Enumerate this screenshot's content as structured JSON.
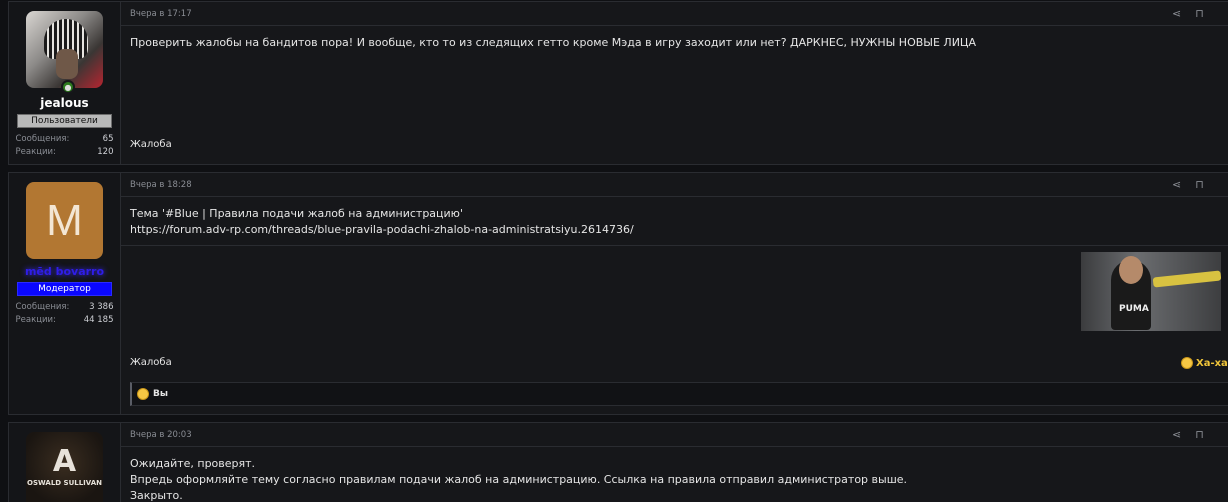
{
  "posts": [
    {
      "user": {
        "name": "jealous",
        "badge": "Пользователи",
        "messages_label": "Сообщения:",
        "messages": "65",
        "reactions_label": "Реакции:",
        "reactions": "120"
      },
      "time": "Вчера в 17:17",
      "body": "Проверить жалобы на бандитов пора! И вообще, кто то из следящих гетто кроме Мэда в игру заходит или нет? ДАРКНЕС, НУЖНЫ НОВЫЕ ЛИЦА",
      "report": "Жалоба"
    },
    {
      "user": {
        "avatar_letter": "M",
        "name": "mēd bovarro",
        "badge": "Модератор",
        "messages_label": "Сообщения:",
        "messages": "3 386",
        "reactions_label": "Реакции:",
        "reactions": "44 185"
      },
      "time": "Вчера в 18:28",
      "body_line1": "Тема '#Blue | Правила подачи жалоб на администрацию'",
      "body_line2": "https://forum.adv-rp.com/threads/blue-pravila-podachi-zhalob-na-administratsiyu.2614736/",
      "thumb_text": "PUMA",
      "report": "Жалоба",
      "reaction_label": "Ха-ха",
      "reactions_by": "Вы"
    },
    {
      "user": {
        "name": "OSWALD SULLIVAN"
      },
      "time": "Вчера в 20:03",
      "body_line1": "Ожидайте, проверят.",
      "body_line2": "Впредь оформляйте тему согласно правилам подачи жалоб на администрацию. Ссылка на правила отправил администратор выше.",
      "body_line3": "Закрыто."
    }
  ],
  "icons": {
    "share": "share-icon",
    "bookmark": "bookmark-icon",
    "online": "online-status-icon",
    "laugh": "laugh-emoji-icon"
  },
  "colors": {
    "moderator_badge": "#0a07ff",
    "moderator_name": "#2f1de8",
    "laugh_reaction": "#f0c53a"
  }
}
